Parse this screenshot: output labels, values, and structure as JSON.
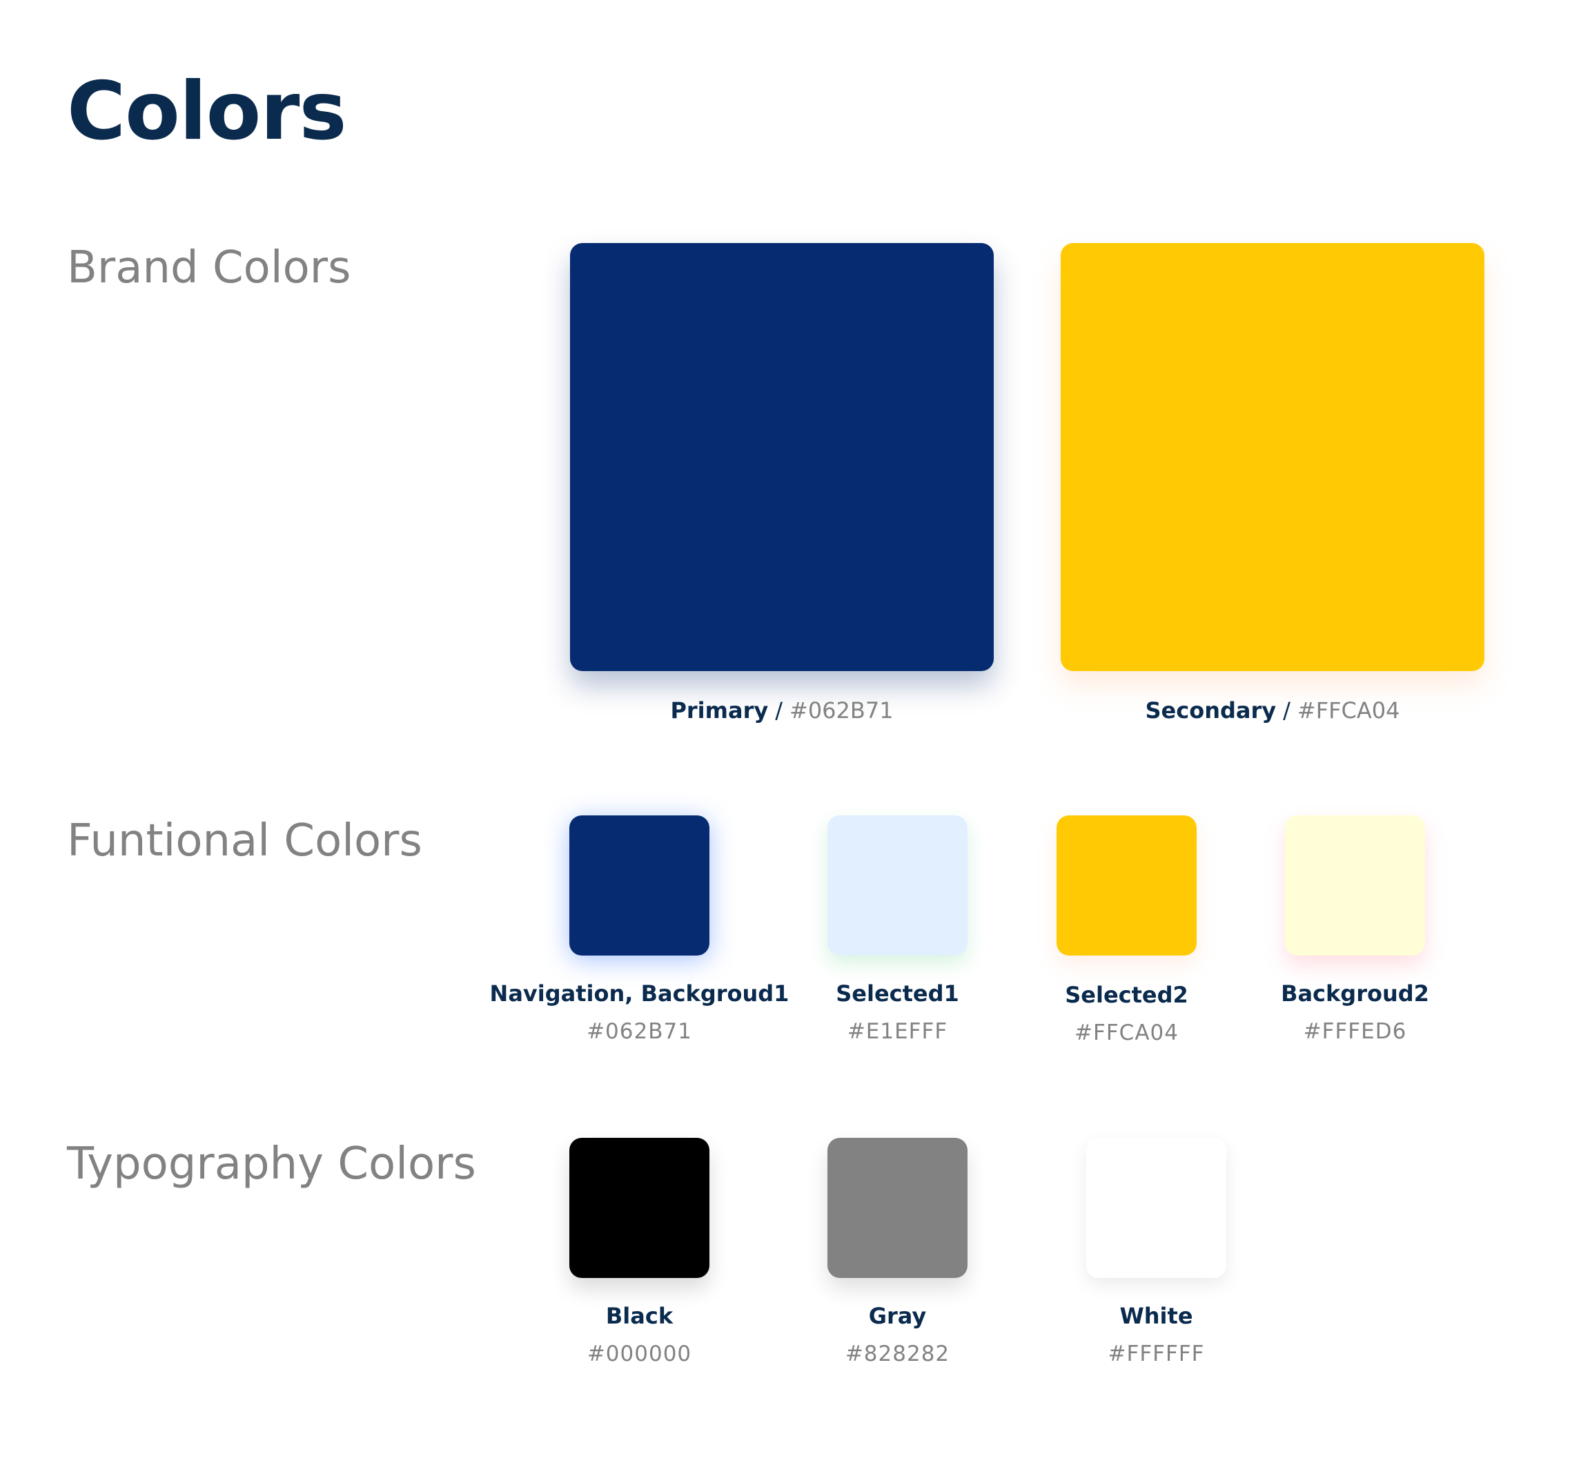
{
  "page": {
    "title": "Colors"
  },
  "sections": {
    "brand": {
      "title": "Brand Colors",
      "swatches": [
        {
          "name": "Primary",
          "separator": "/",
          "hex": "#062B71",
          "color": "#062B71"
        },
        {
          "name": "Secondary",
          "separator": "/",
          "hex": "#FFCA04",
          "color": "#FFCA04"
        }
      ]
    },
    "functional": {
      "title": "Funtional Colors",
      "swatches": [
        {
          "name": "Navigation, Backgroud1",
          "hex": "#062B71",
          "color": "#062B71"
        },
        {
          "name": "Selected1",
          "hex": "#E1EFFF",
          "color": "#E1EFFF"
        },
        {
          "name": "Selected2",
          "hex": "#FFCA04",
          "color": "#FFCA04"
        },
        {
          "name": "Backgroud2",
          "hex": "#FFFED6",
          "color": "#FFFED6"
        }
      ]
    },
    "typography": {
      "title": "Typography Colors",
      "swatches": [
        {
          "name": "Black",
          "hex": "#000000",
          "color": "#000000"
        },
        {
          "name": "Gray",
          "hex": "#828282",
          "color": "#828282"
        },
        {
          "name": "White",
          "hex": "#FFFFFF",
          "color": "#FFFFFF"
        }
      ]
    }
  },
  "theme": {
    "heading_color": "#0B2B4E",
    "muted_text_color": "#828282"
  }
}
